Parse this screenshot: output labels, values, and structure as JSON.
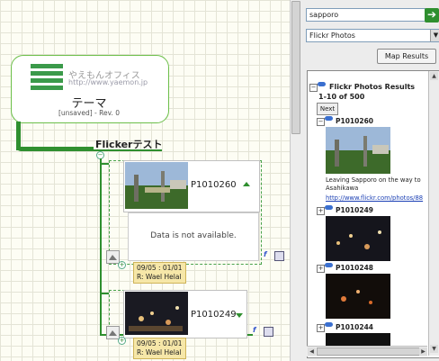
{
  "central_topic": {
    "logo_text_jp": "やえもんオフィス",
    "logo_url": "http://www.yaemon.jp",
    "title": "テーマ",
    "status": "[unsaved] - Rev. 0"
  },
  "subtopic": {
    "title": "Flickerテスト"
  },
  "photo_nodes": [
    {
      "label": "P1010260",
      "not_available": "Data is not available.",
      "date_range": "09/05 : 01/01",
      "resource": "R: Wael Helal"
    },
    {
      "label": "P1010249",
      "date_range": "09/05 : 01/01",
      "resource": "R: Wael Helal"
    }
  ],
  "search_panel": {
    "query": "sapporo",
    "source_selected": "Flickr Photos",
    "map_button": "Map Results",
    "results_header": "Flickr Photos Results",
    "results_count": "1-10 of 500",
    "next_button": "Next",
    "results": [
      {
        "id": "P1010260",
        "description": "Leaving Sapporo on the way to Asahikawa",
        "link": "http://www.flickr.com/photos/88"
      },
      {
        "id": "P1010249"
      },
      {
        "id": "P1010248"
      },
      {
        "id": "P1010244"
      }
    ]
  },
  "colors": {
    "accent_green": "#2f8f2f",
    "node_border": "#6cbf4a",
    "note_bg": "#f6e7a8"
  }
}
